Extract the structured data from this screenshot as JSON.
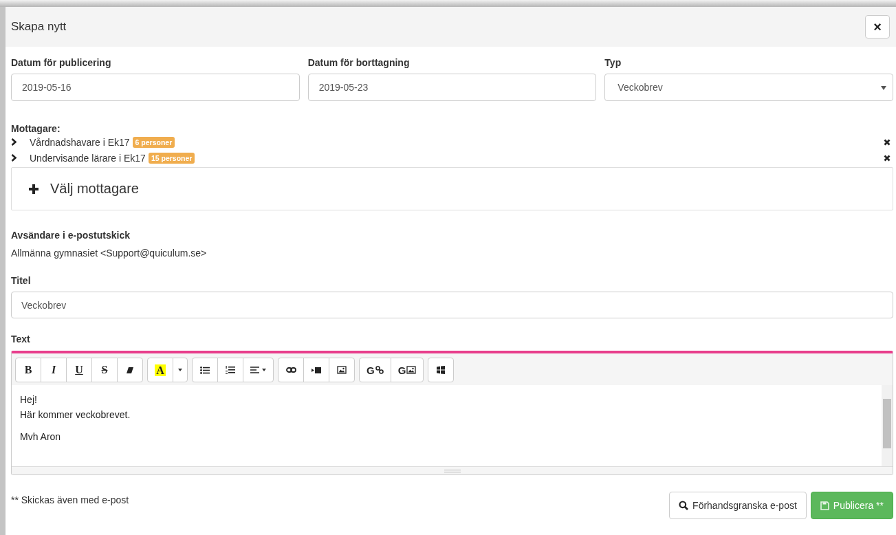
{
  "dialog": {
    "title": "Skapa nytt",
    "close": "×"
  },
  "fields": [
    {
      "label": "Datum för publicering",
      "value": "2019-05-16",
      "kind": "input"
    },
    {
      "label": "Datum för borttagning",
      "value": "2019-05-23",
      "kind": "input"
    },
    {
      "label": "Typ",
      "value": "Veckobrev",
      "kind": "select"
    }
  ],
  "recipients": {
    "label": "Mottagare:",
    "items": [
      {
        "name": "Vårdnadshavare i Ek17",
        "count": "6 personer",
        "expanded": false
      },
      {
        "name": "Undervisande lärare i Ek17",
        "count": "15 personer",
        "expanded": false
      }
    ],
    "add_button": "Välj mottagare"
  },
  "sender": {
    "label": "Avsändare i e-postutskick",
    "value": "Allmänna gymnasiet <Support@quiculum.se>"
  },
  "title_field": {
    "label": "Titel",
    "value": "Veckobrev"
  },
  "editor": {
    "label": "Text",
    "toolbar": [
      [
        {
          "kind": "bold",
          "label": "B"
        },
        {
          "kind": "italic",
          "label": "I"
        },
        {
          "kind": "underline",
          "label": "U"
        },
        {
          "kind": "strike",
          "label": "S"
        },
        {
          "kind": "eraser"
        }
      ],
      [
        {
          "kind": "color",
          "label": "A"
        },
        {
          "kind": "caret"
        }
      ],
      [
        {
          "kind": "ul"
        },
        {
          "kind": "ol"
        },
        {
          "kind": "align"
        }
      ],
      [
        {
          "kind": "link"
        },
        {
          "kind": "video"
        },
        {
          "kind": "image"
        }
      ],
      [
        {
          "kind": "glink",
          "label": "G"
        },
        {
          "kind": "gimage",
          "label": "G"
        }
      ],
      [
        {
          "kind": "windows"
        }
      ]
    ],
    "paragraphs": [
      [
        "Hej!",
        "Här kommer veckobrevet."
      ],
      [
        "Mvh Aron"
      ]
    ]
  },
  "footer": {
    "note": "** Skickas även med e-post",
    "preview_button": "Förhandsgranska e-post",
    "publish_button": "Publicera **"
  }
}
